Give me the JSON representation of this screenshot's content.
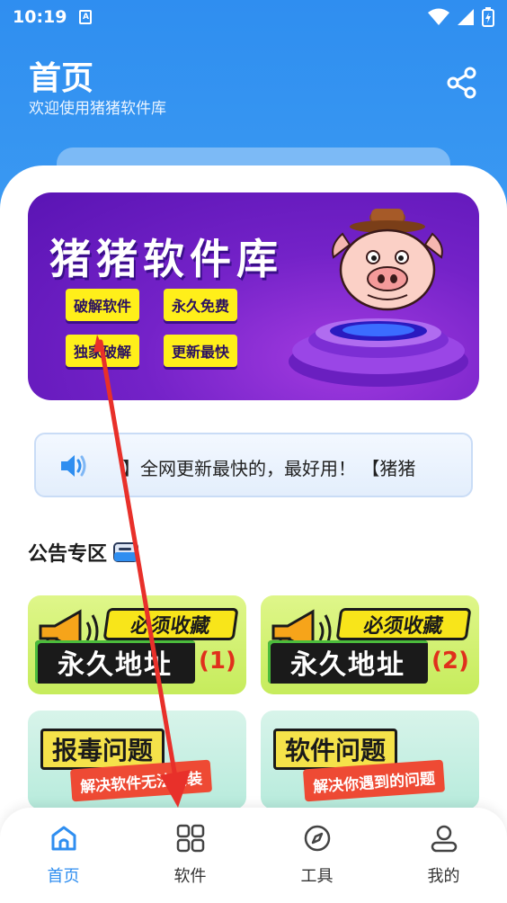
{
  "status_bar": {
    "time": "10:19",
    "notif_letter": "A"
  },
  "header": {
    "title": "首页",
    "subtitle": "欢迎使用猪猪软件库"
  },
  "banner": {
    "title": "猪猪软件库",
    "tags": [
      "破解软件",
      "永久免费",
      "独家破解",
      "更新最快"
    ]
  },
  "notice": {
    "text": "】全网更新最快的，最好用！ 【猪猪"
  },
  "section": {
    "title": "公告专区"
  },
  "tiles": [
    {
      "top": "必须收藏",
      "main": "永久地址",
      "num": "(1)"
    },
    {
      "top": "必须收藏",
      "main": "永久地址",
      "num": "(2)"
    },
    {
      "head": "报毒问题",
      "sub": "解决软件无法安装"
    },
    {
      "head": "软件问题",
      "sub": "解决你遇到的问题"
    }
  ],
  "tabbar": {
    "items": [
      {
        "label": "首页",
        "icon": "home-icon",
        "active": true
      },
      {
        "label": "软件",
        "icon": "grid-icon",
        "active": false
      },
      {
        "label": "工具",
        "icon": "compass-icon",
        "active": false
      },
      {
        "label": "我的",
        "icon": "user-icon",
        "active": false
      }
    ]
  },
  "colors": {
    "accent": "#2f8ef0",
    "banner_purple": "#7422c8",
    "tag_yellow": "#ffef1a",
    "annotation_red": "#e8302a"
  }
}
